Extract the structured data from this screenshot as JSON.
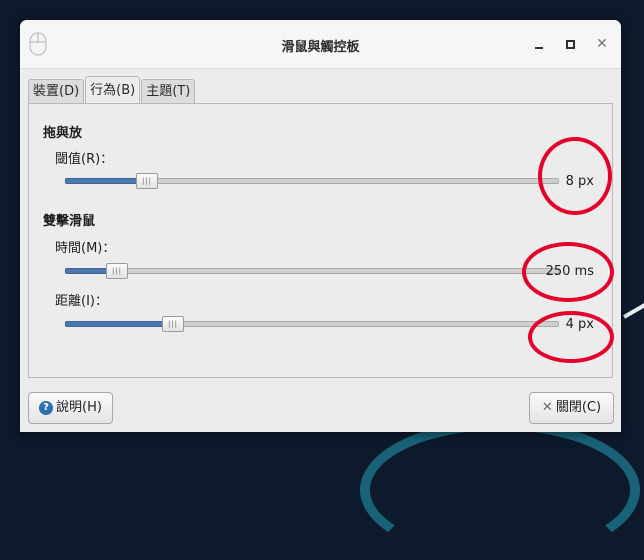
{
  "window": {
    "title": "滑鼠與觸控板",
    "app_icon": "mouse-icon",
    "controls": [
      "minimize-icon",
      "maximize-icon",
      "close-icon"
    ]
  },
  "tabs": [
    {
      "label": "裝置(D)",
      "active": false
    },
    {
      "label": "行為(B)",
      "active": true
    },
    {
      "label": "主題(T)",
      "active": false
    }
  ],
  "drag_drop": {
    "title": "拖與放",
    "threshold": {
      "label": "閾值(R)：",
      "value_text": "8 px",
      "value": 8,
      "min": 1,
      "max": 50
    }
  },
  "double_click": {
    "title": "雙擊滑鼠",
    "time": {
      "label": "時間(M)：",
      "value_text": "250 ms",
      "value": 250,
      "min": 100,
      "max": 2000
    },
    "distance": {
      "label": "距離(I)：",
      "value_text": "4 px",
      "value": 4,
      "min": 0,
      "max": 20
    }
  },
  "buttons": {
    "help": "說明(H)",
    "close": "關閉(C)"
  },
  "annotation": {
    "color": "#e4002b"
  },
  "colors": {
    "slider_fill": "#4c78b0"
  }
}
